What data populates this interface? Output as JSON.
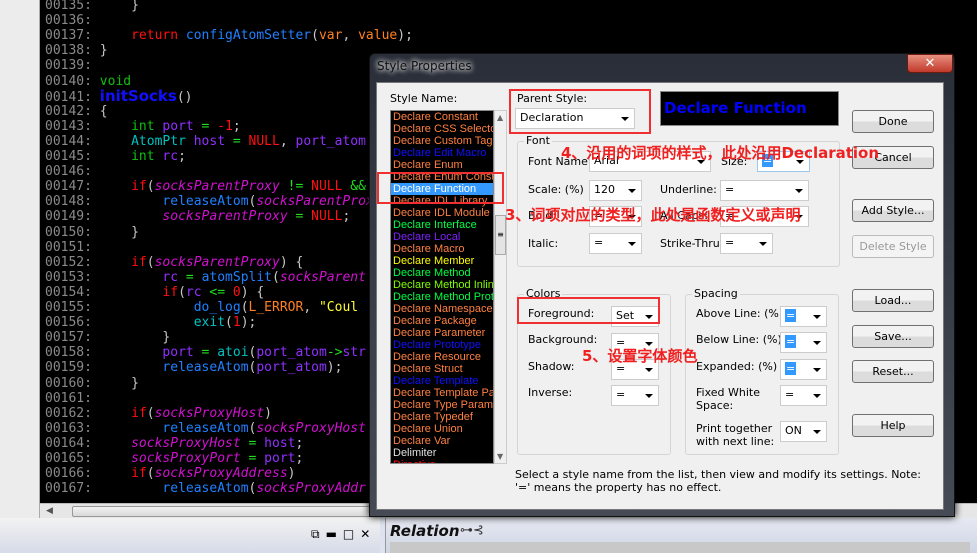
{
  "code": [
    {
      "num": "00135:",
      "tokens": [
        [
          "    }",
          "p"
        ]
      ]
    },
    {
      "num": "00136:",
      "tokens": []
    },
    {
      "num": "00137:",
      "tokens": [
        [
          "    ",
          "p"
        ],
        [
          "return",
          "k"
        ],
        [
          " ",
          "p"
        ],
        [
          "configAtomSetter",
          "f"
        ],
        [
          "(",
          "p"
        ],
        [
          "var",
          "c"
        ],
        [
          ", ",
          "p"
        ],
        [
          "value",
          "c"
        ],
        [
          ");",
          "p"
        ]
      ]
    },
    {
      "num": "00138:",
      "tokens": [
        [
          "}",
          "p"
        ]
      ]
    },
    {
      "num": "00139:",
      "tokens": []
    },
    {
      "num": "00140:",
      "tokens": [
        [
          "void",
          "t"
        ]
      ]
    },
    {
      "num": "00141:",
      "tokens": [
        [
          "initSocks",
          "fn"
        ],
        [
          "()",
          "p"
        ]
      ]
    },
    {
      "num": "00142:",
      "tokens": [
        [
          "{",
          "p"
        ]
      ]
    },
    {
      "num": "00143:",
      "tokens": [
        [
          "    ",
          "p"
        ],
        [
          "int",
          "t"
        ],
        [
          " ",
          "p"
        ],
        [
          "port",
          "v"
        ],
        [
          " = ",
          "o"
        ],
        [
          "-1",
          "n"
        ],
        [
          ";",
          "p"
        ]
      ]
    },
    {
      "num": "00144:",
      "tokens": [
        [
          "    ",
          "p"
        ],
        [
          "AtomPtr",
          "ty"
        ],
        [
          " ",
          "p"
        ],
        [
          "host",
          "v"
        ],
        [
          " = ",
          "o"
        ],
        [
          "NULL",
          "n"
        ],
        [
          ", ",
          "p"
        ],
        [
          "port_atom",
          "v"
        ]
      ]
    },
    {
      "num": "00145:",
      "tokens": [
        [
          "    ",
          "p"
        ],
        [
          "int",
          "t"
        ],
        [
          " ",
          "p"
        ],
        [
          "rc",
          "v"
        ],
        [
          ";",
          "p"
        ]
      ]
    },
    {
      "num": "00146:",
      "tokens": []
    },
    {
      "num": "00147:",
      "tokens": [
        [
          "    ",
          "p"
        ],
        [
          "if",
          "k"
        ],
        [
          "(",
          "p"
        ],
        [
          "socksParentProxy",
          "g"
        ],
        [
          " != ",
          "o"
        ],
        [
          "NULL",
          "n"
        ],
        [
          " &&",
          "o"
        ]
      ]
    },
    {
      "num": "00148:",
      "tokens": [
        [
          "        ",
          "p"
        ],
        [
          "releaseAtom",
          "f"
        ],
        [
          "(",
          "p"
        ],
        [
          "socksParentProxy",
          "g"
        ]
      ]
    },
    {
      "num": "00149:",
      "tokens": [
        [
          "        ",
          "p"
        ],
        [
          "socksParentProxy",
          "g"
        ],
        [
          " = ",
          "o"
        ],
        [
          "NULL",
          "n"
        ],
        [
          ";",
          "p"
        ]
      ]
    },
    {
      "num": "00150:",
      "tokens": [
        [
          "    }",
          "p"
        ]
      ]
    },
    {
      "num": "00151:",
      "tokens": []
    },
    {
      "num": "00152:",
      "tokens": [
        [
          "    ",
          "p"
        ],
        [
          "if",
          "k"
        ],
        [
          "(",
          "p"
        ],
        [
          "socksParentProxy",
          "g"
        ],
        [
          ") {",
          "p"
        ]
      ]
    },
    {
      "num": "00153:",
      "tokens": [
        [
          "        ",
          "p"
        ],
        [
          "rc",
          "v"
        ],
        [
          " = ",
          "o"
        ],
        [
          "atomSplit",
          "f"
        ],
        [
          "(",
          "p"
        ],
        [
          "socksParent",
          "g"
        ]
      ]
    },
    {
      "num": "00154:",
      "tokens": [
        [
          "        ",
          "p"
        ],
        [
          "if",
          "k"
        ],
        [
          "(",
          "p"
        ],
        [
          "rc",
          "v"
        ],
        [
          " <= ",
          "o"
        ],
        [
          "0",
          "n"
        ],
        [
          ") {",
          "p"
        ]
      ]
    },
    {
      "num": "00155:",
      "tokens": [
        [
          "            ",
          "p"
        ],
        [
          "do_log",
          "f"
        ],
        [
          "(",
          "p"
        ],
        [
          "L_ERROR",
          "c"
        ],
        [
          ", ",
          "p"
        ],
        [
          "\"Coul",
          "s"
        ]
      ]
    },
    {
      "num": "00156:",
      "tokens": [
        [
          "            ",
          "p"
        ],
        [
          "exit",
          "ty"
        ],
        [
          "(",
          "p"
        ],
        [
          "1",
          "n"
        ],
        [
          ");",
          "p"
        ]
      ]
    },
    {
      "num": "00157:",
      "tokens": [
        [
          "        }",
          "p"
        ]
      ]
    },
    {
      "num": "00158:",
      "tokens": [
        [
          "        ",
          "p"
        ],
        [
          "port",
          "v"
        ],
        [
          " = ",
          "o"
        ],
        [
          "atoi",
          "ty"
        ],
        [
          "(",
          "p"
        ],
        [
          "port_atom",
          "v"
        ],
        [
          "->",
          "o"
        ],
        [
          "str",
          "v"
        ]
      ]
    },
    {
      "num": "00159:",
      "tokens": [
        [
          "        ",
          "p"
        ],
        [
          "releaseAtom",
          "f"
        ],
        [
          "(",
          "p"
        ],
        [
          "port_atom",
          "v"
        ],
        [
          ");",
          "p"
        ]
      ]
    },
    {
      "num": "00160:",
      "tokens": [
        [
          "    }",
          "p"
        ]
      ]
    },
    {
      "num": "00161:",
      "tokens": []
    },
    {
      "num": "00162:",
      "tokens": [
        [
          "    ",
          "p"
        ],
        [
          "if",
          "k"
        ],
        [
          "(",
          "p"
        ],
        [
          "socksProxyHost",
          "g"
        ],
        [
          ")",
          "p"
        ]
      ]
    },
    {
      "num": "00163:",
      "tokens": [
        [
          "        ",
          "p"
        ],
        [
          "releaseAtom",
          "f"
        ],
        [
          "(",
          "p"
        ],
        [
          "socksProxyHost",
          "g"
        ]
      ]
    },
    {
      "num": "00164:",
      "tokens": [
        [
          "    ",
          "p"
        ],
        [
          "socksProxyHost",
          "g"
        ],
        [
          " = ",
          "o"
        ],
        [
          "host",
          "v"
        ],
        [
          ";",
          "p"
        ]
      ]
    },
    {
      "num": "00165:",
      "tokens": [
        [
          "    ",
          "p"
        ],
        [
          "socksProxyPort",
          "g"
        ],
        [
          " = ",
          "o"
        ],
        [
          "port",
          "v"
        ],
        [
          ";",
          "p"
        ]
      ]
    },
    {
      "num": "00166:",
      "tokens": [
        [
          "    ",
          "p"
        ],
        [
          "if",
          "k"
        ],
        [
          "(",
          "p"
        ],
        [
          "socksProxyAddress",
          "g"
        ],
        [
          ")",
          "p"
        ]
      ]
    },
    {
      "num": "00167:",
      "tokens": [
        [
          "        ",
          "p"
        ],
        [
          "releaseAtom",
          "f"
        ],
        [
          "(",
          "p"
        ],
        [
          "socksProxyAddr",
          "g"
        ]
      ]
    }
  ],
  "dialog": {
    "title": "Style Properties",
    "close": "✕",
    "style_name_label": "Style Name:",
    "styles": [
      {
        "name": "Declare Constant",
        "color": "#ff8040"
      },
      {
        "name": "Declare CSS Selector",
        "color": "#ff8040"
      },
      {
        "name": "Declare Custom Tag",
        "color": "#ff8040"
      },
      {
        "name": "Declare Edit Macro",
        "color": "#1010ff"
      },
      {
        "name": "Declare Enum",
        "color": "#ff8040"
      },
      {
        "name": "Declare Enum Const",
        "color": "#ff8040"
      },
      {
        "name": "Declare Function",
        "color": "#ffffff",
        "selected": true
      },
      {
        "name": "Declare IDL Library",
        "color": "#ff8040"
      },
      {
        "name": "Declare IDL Module",
        "color": "#ff8040"
      },
      {
        "name": "Declare Interface",
        "color": "#00ff40"
      },
      {
        "name": "Declare Local",
        "color": "#8020ff"
      },
      {
        "name": "Declare Macro",
        "color": "#ff8040"
      },
      {
        "name": "Declare Member",
        "color": "#ffff00"
      },
      {
        "name": "Declare Method",
        "color": "#00ff40"
      },
      {
        "name": "Declare Method Inline",
        "color": "#80ff00"
      },
      {
        "name": "Declare Method Prototype",
        "color": "#00ff40"
      },
      {
        "name": "Declare Namespace",
        "color": "#ff8040"
      },
      {
        "name": "Declare Package",
        "color": "#ff8040"
      },
      {
        "name": "Declare Parameter",
        "color": "#ff8040"
      },
      {
        "name": "Declare Prototype",
        "color": "#1010ff"
      },
      {
        "name": "Declare Resource",
        "color": "#ff8040"
      },
      {
        "name": "Declare Struct",
        "color": "#ff8040"
      },
      {
        "name": "Declare Template",
        "color": "#1010ff"
      },
      {
        "name": "Declare Template Param",
        "color": "#ff8040"
      },
      {
        "name": "Declare Type Parameter",
        "color": "#ff8040"
      },
      {
        "name": "Declare Typedef",
        "color": "#ff8040"
      },
      {
        "name": "Declare Union",
        "color": "#ff8040"
      },
      {
        "name": "Declare Var",
        "color": "#ff8040"
      },
      {
        "name": "Delimiter",
        "color": "#e0e0e0"
      },
      {
        "name": "Directive",
        "color": "#ff1010"
      }
    ],
    "parent_style_label": "Parent Style:",
    "parent_style_value": "Declaration",
    "preview_text": "Declare Function",
    "preview_color": "#0000ff",
    "font": {
      "title": "Font",
      "font_name_label": "Font Name:",
      "font_name_value": "Arial",
      "size_label": "Size:",
      "size_value": "=",
      "scale_label": "Scale: (%)",
      "scale_value": "120",
      "underline_label": "Underline:",
      "underline_value": "=",
      "bold_label": "Bold:",
      "bold_value": "=",
      "allcaps_label": "All Caps:",
      "allcaps_value": "=",
      "italic_label": "Italic:",
      "italic_value": "=",
      "strike_label": "Strike-Thru:",
      "strike_value": "="
    },
    "colors": {
      "title": "Colors",
      "fg_label": "Foreground:",
      "fg_value": "Set",
      "bg_label": "Background:",
      "bg_value": "=",
      "shadow_label": "Shadow:",
      "shadow_value": "=",
      "inverse_label": "Inverse:",
      "inverse_value": "="
    },
    "spacing": {
      "title": "Spacing",
      "above_label": "Above Line: (%)",
      "above_value": "=",
      "below_label": "Below Line: (%)",
      "below_value": "=",
      "expanded_label": "Expanded: (%)",
      "expanded_value": "=",
      "fixed_label": "Fixed White Space:",
      "fixed_value": "=",
      "print_label": "Print together with next line:",
      "print_value": "ON"
    },
    "buttons": {
      "done": "Done",
      "cancel": "Cancel",
      "add": "Add Style...",
      "delete": "Delete Style",
      "load": "Load...",
      "save": "Save...",
      "reset": "Reset...",
      "help": "Help"
    },
    "footer": "Select a style name from the list, then view and modify its settings. Note: '=' means the property has no effect."
  },
  "annotations": {
    "note4": "4、沿用的词项的样式，此处沿用Declaration",
    "note3": "3、词项对应的类型，此处是函数定义或声明",
    "note5": "5、设置字体颜色"
  },
  "bottom": {
    "relation_title": "Relation",
    "pane_icons": [
      "restore-icon",
      "minimize-icon",
      "maximize-icon",
      "close-icon"
    ]
  }
}
